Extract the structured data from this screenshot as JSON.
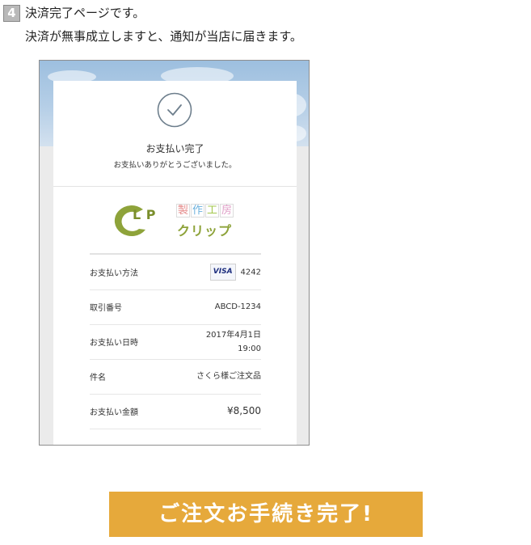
{
  "step": {
    "number": "4",
    "title": "決済完了ページです。",
    "description": "決済が無事成立しますと、通知が当店に届きます。"
  },
  "payment": {
    "icon": "check-circle-icon",
    "title": "お支払い完了",
    "message": "お支払いありがとうございました。"
  },
  "shop_logo": {
    "lip_text": "L P",
    "kanji": [
      "製",
      "作",
      "工",
      "房"
    ],
    "kana": "クリップ",
    "brand_color": "#7a8e2b"
  },
  "details": [
    {
      "label": "お支払い方法",
      "card_brand": "VISA",
      "value": "4242"
    },
    {
      "label": "取引番号",
      "value": "ABCD-1234"
    },
    {
      "label": "お支払い日時",
      "value": "2017年4月1日",
      "value2": "19:00"
    },
    {
      "label": "件名",
      "value": "さくら様ご注文品"
    },
    {
      "label": "お支払い金額",
      "value": "¥8,500"
    }
  ],
  "complete_button": {
    "label": "ご注文お手続き完了!",
    "color": "#e6a93b"
  }
}
